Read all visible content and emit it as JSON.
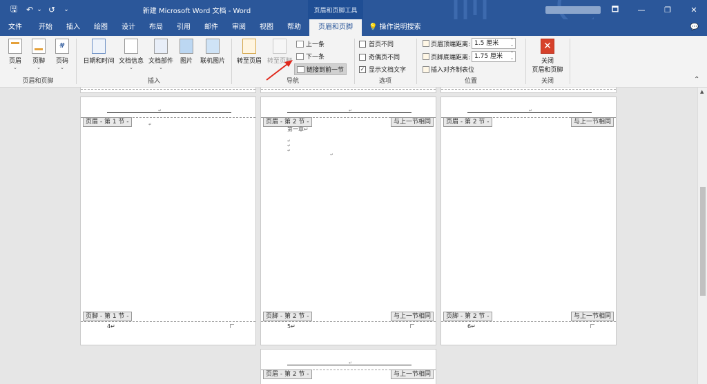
{
  "window": {
    "title": "新建 Microsoft Word 文档 - Word",
    "context_tab_group": "页眉和页脚工具",
    "controls": [
      "🗖",
      "—",
      "❐",
      "✕"
    ]
  },
  "qat": {
    "save": "🖫",
    "undo": "↶",
    "undo_dd": "⌄",
    "redo": "↺",
    "customize": "⌄"
  },
  "tabs": [
    "文件",
    "开始",
    "插入",
    "绘图",
    "设计",
    "布局",
    "引用",
    "邮件",
    "审阅",
    "视图",
    "帮助",
    "页眉和页脚"
  ],
  "active_tab": "页眉和页脚",
  "tell_me": "操作说明搜索",
  "ribbon": {
    "group_hf": {
      "title": "页眉和页脚",
      "header": "页眉",
      "footer": "页脚",
      "page_number": "页码",
      "page_number_icon": "#"
    },
    "group_insert": {
      "title": "插入",
      "datetime": "日期和时间",
      "docinfo": "文档信息",
      "quickparts": "文档部件",
      "picture": "图片",
      "online_picture": "联机图片"
    },
    "group_nav": {
      "title": "导航",
      "goto_header": "转至页眉",
      "goto_footer": "转至页脚",
      "previous": "上一条",
      "next": "下一条",
      "link_previous": "链接到前一节"
    },
    "group_options": {
      "title": "选项",
      "diff_first": "首页不同",
      "diff_oddeven": "奇偶页不同",
      "show_text": "显示文档文字",
      "show_text_checked": "✓"
    },
    "group_position": {
      "title": "位置",
      "header_top_label": "页眉顶端距离:",
      "header_top_value": "1.5 厘米",
      "footer_bottom_label": "页脚底端距离:",
      "footer_bottom_value": "1.75 厘米",
      "align_tab": "插入对齐制表位"
    },
    "group_close": {
      "title": "关闭",
      "close_icon": "✕",
      "close_line1": "关闭",
      "close_line2": "页眉和页脚"
    }
  },
  "pages": {
    "p1": {
      "header_tag": "页眉 - 第 1 节 -",
      "footer_tag": "页脚 - 第 1 节 -",
      "page_number": "4↵"
    },
    "p2": {
      "header_tag": "页眉 - 第 2 节 -",
      "footer_tag": "页脚 - 第 2 节 -",
      "same_header": "与上一节相同",
      "same_footer": "与上一节相同",
      "page_number": "5↵",
      "body_text": "第一章↵"
    },
    "p3": {
      "header_tag": "页眉 - 第 2 节 -",
      "footer_tag": "页脚 - 第 2 节 -",
      "same_header": "与上一节相同",
      "same_footer": "与上一节相同",
      "page_number": "6↵"
    },
    "p4": {
      "header_tag": "页眉 - 第 2 节 -",
      "same_header": "与上一节相同"
    }
  },
  "colors": {
    "word_blue": "#2b579a",
    "close_red": "#d6412b",
    "annotation_red": "#e0271b"
  }
}
